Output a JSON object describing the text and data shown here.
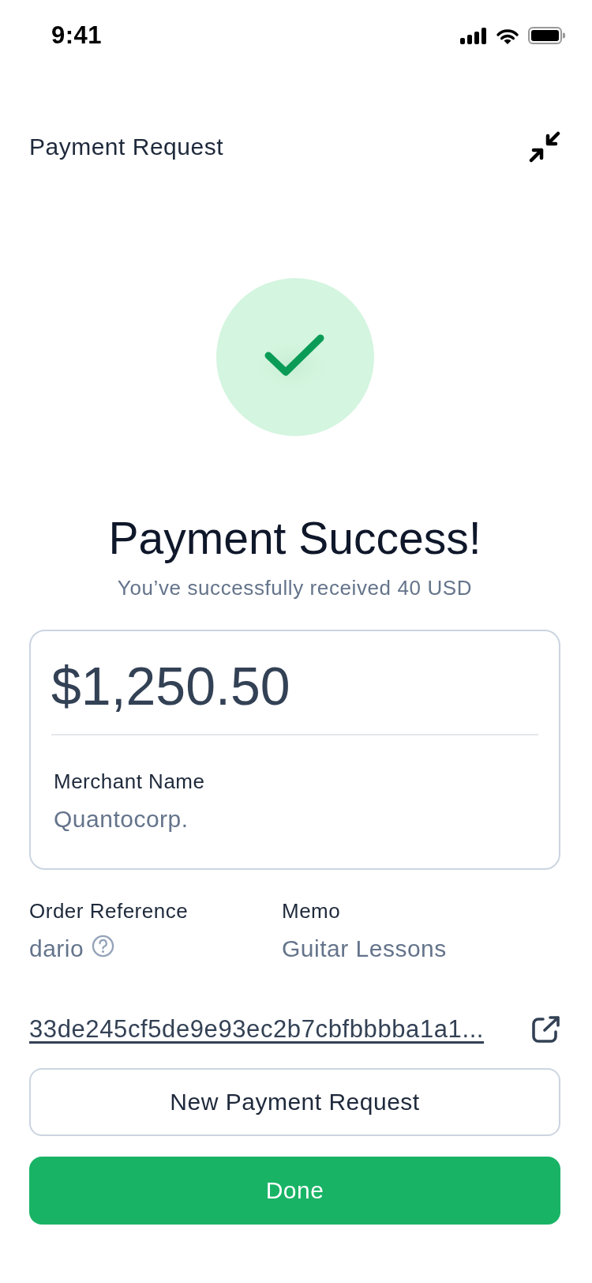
{
  "status_bar": {
    "time": "9:41"
  },
  "header": {
    "title": "Payment Request"
  },
  "result": {
    "kind": "success",
    "title": "Payment Success!",
    "subtitle": "You’ve successfully received 40 USD"
  },
  "amount_card": {
    "amount": "$1,250.50",
    "fields": [
      {
        "label": "Merchant Name",
        "value": "Quantocorp."
      }
    ]
  },
  "details": [
    {
      "label": "Order Reference",
      "value": "dario",
      "help": true
    },
    {
      "label": "Memo",
      "value": "Guitar Lessons",
      "help": false
    }
  ],
  "transaction_link": {
    "text": "33de245cf5de9e93ec2b7cbfbbbba1a1..."
  },
  "buttons": [
    {
      "label": "New Payment Request",
      "kind": "secondary"
    },
    {
      "label": "Done",
      "kind": "primary"
    }
  ]
}
